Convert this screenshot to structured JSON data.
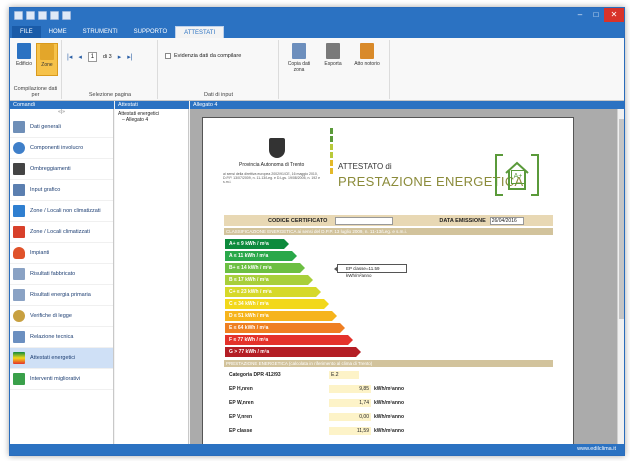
{
  "window": {
    "buttons": [
      "–",
      "□",
      "✕"
    ],
    "accent": "#2b72c2"
  },
  "ribbon": {
    "tabs": [
      "FILE",
      "HOME",
      "STRUMENTI",
      "SUPPORTO",
      "ATTESTATI"
    ],
    "groups": {
      "compilazione": {
        "label": "Compilazione dati per",
        "buttons": [
          "Edificio",
          "Zone"
        ]
      },
      "selezione": {
        "label": "Selezione pagina",
        "page": "1",
        "of_pages": "di 3"
      },
      "dati_input": {
        "label": "Dati di input",
        "checkbox": "Evidenzia dati da compilare"
      },
      "azioni": {
        "buttons": [
          "Copia dati zona",
          "Esporta",
          "Atto notorio"
        ]
      }
    }
  },
  "left_pane": {
    "title": "Comandi",
    "items": [
      {
        "label": "Dati generali",
        "icon": "document-icon"
      },
      {
        "label": "Componenti involucro",
        "icon": "cloud-icon"
      },
      {
        "label": "Ombreggiamenti",
        "icon": "shadow-icon"
      },
      {
        "label": "Input grafico",
        "icon": "graphic-input-icon"
      },
      {
        "label": "Zone / Locali non climatizzati",
        "icon": "roof-icon"
      },
      {
        "label": "Zone / Locali climatizzati",
        "icon": "roof-heated-icon"
      },
      {
        "label": "Impianti",
        "icon": "flame-icon"
      },
      {
        "label": "Risultati fabbricato",
        "icon": "calculator-icon"
      },
      {
        "label": "Risultati energia primaria",
        "icon": "calculator-icon"
      },
      {
        "label": "Verifiche di legge",
        "icon": "stamp-icon"
      },
      {
        "label": "Relazione tecnica",
        "icon": "report-icon"
      },
      {
        "label": "Attestati energetici",
        "icon": "chart-icon"
      },
      {
        "label": "Interventi migliorativi",
        "icon": "house-icon"
      }
    ]
  },
  "mid_pane": {
    "title": "Attestati",
    "tree": [
      "Attestati energetici",
      "– Allegato 4"
    ]
  },
  "right_pane": {
    "title": "Allegato 4"
  },
  "document": {
    "province": "Provincia Autonoma di Trento",
    "small_text": "ai sensi della direttiva europea 2002/91/CE, 16 maggio 2010, D.P.P. 13/07/2009, n. 11-13/Leg. e D.Lgs. 19/08/2005, n. 192 e s.m.i.",
    "attestato": "ATTESTATO di",
    "prestazione": "PRESTAZIONE ENERGETICA",
    "logo_badge": "A+",
    "codice_label": "CODICE CERTIFICATO",
    "data_label": "DATA EMISSIONE",
    "data_value": "26/04/2016",
    "section1": "CLASSIFICAZIONE ENERGETICA ai sensi del D.P.P. 13 luglio 2009, n. 11-13/Leg. e s.m.i.",
    "section2": "PRESTAZIONE ENERGETICA (calcolata in riferimento al clima di Trento)",
    "classes": [
      {
        "label": "A+ ≤ 9 kWh / m²a",
        "color": "#0d8a3c",
        "width": 64
      },
      {
        "label": "A ≤ 11 kWh / m²a",
        "color": "#2aa84a",
        "width": 72
      },
      {
        "label": "B+ ≤ 14 kWh / m²a",
        "color": "#6cbf42",
        "width": 80
      },
      {
        "label": "B ≤ 17 kWh / m²a",
        "color": "#a8cf3a",
        "width": 88
      },
      {
        "label": "C+ ≤ 23 kWh / m²a",
        "color": "#d6d92a",
        "width": 96
      },
      {
        "label": "C ≤ 34 kWh / m²a",
        "color": "#f2d81b",
        "width": 104
      },
      {
        "label": "D ≤ 51 kWh / m²a",
        "color": "#f6b41c",
        "width": 112
      },
      {
        "label": "E ≤ 64 kWh / m²a",
        "color": "#ef7f22",
        "width": 120
      },
      {
        "label": "F ≤ 77 kWh / m²a",
        "color": "#e4322b",
        "width": 128
      },
      {
        "label": "G > 77 kWh / m²a",
        "color": "#b41e25",
        "width": 136
      }
    ],
    "ep_flag": "EP classe=11.59 kWh/m²anno",
    "rows": [
      {
        "label": "Categoria DPR 412/93",
        "value": "E.2",
        "unit": ""
      },
      {
        "label": "EP H,nren",
        "value": "9,85",
        "unit": "kWh/m²anno"
      },
      {
        "label": "EP W,nren",
        "value": "1,74",
        "unit": "kWh/m²anno"
      },
      {
        "label": "EP V,nren",
        "value": "0,00",
        "unit": "kWh/m²anno"
      },
      {
        "label": "EP classe",
        "value": "11,59",
        "unit": "kWh/m²anno"
      }
    ]
  },
  "status": {
    "url": "www.edilclima.it"
  }
}
